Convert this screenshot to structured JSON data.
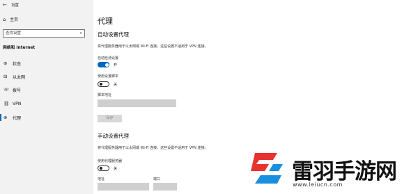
{
  "window": {
    "back_glyph": "←",
    "title": "设置"
  },
  "sidebar": {
    "home_label": "主页",
    "search_placeholder": "查找设置",
    "section_label": "网络和 Internet",
    "items": [
      {
        "icon": "globe-icon",
        "glyph": "⊕",
        "label": "状态"
      },
      {
        "icon": "ethernet-icon",
        "glyph": "⊟",
        "label": "以太网"
      },
      {
        "icon": "dialup-icon",
        "glyph": "☏",
        "label": "拨号"
      },
      {
        "icon": "vpn-icon",
        "glyph": "⛓",
        "label": "VPN"
      },
      {
        "icon": "proxy-icon",
        "glyph": "⊕",
        "label": "代理"
      }
    ],
    "active_index": 4
  },
  "main": {
    "title": "代理",
    "auto": {
      "heading": "自动设置代理",
      "desc": "将代理服务器用于以太网或 Wi-Fi 连接。这些设置不适用于 VPN 连接。",
      "detect_label": "自动检测设置",
      "detect_state": "开",
      "detect_on": true,
      "script_label": "使用设置脚本",
      "script_state": "关",
      "script_on": false,
      "address_label": "脚本地址",
      "address_value": "",
      "save_label": "保存"
    },
    "manual": {
      "heading": "手动设置代理",
      "desc": "将代理服务器用于以太网或 Wi-Fi 连接。这些设置不适用于 VPN 连接。",
      "use_proxy_label": "使用代理服务器",
      "use_proxy_state": "关",
      "use_proxy_on": false,
      "address_label": "地址",
      "port_label": "端口",
      "address_value": "",
      "port_value": ""
    }
  },
  "watermark": {
    "brand": "雷羽手游网",
    "url": "www.leiucn.com"
  },
  "colors": {
    "accent": "#0067c0",
    "logo_red": "#e8322f",
    "logo_blue": "#1a8fe0",
    "sidebar_bg": "#f2f2f2"
  }
}
